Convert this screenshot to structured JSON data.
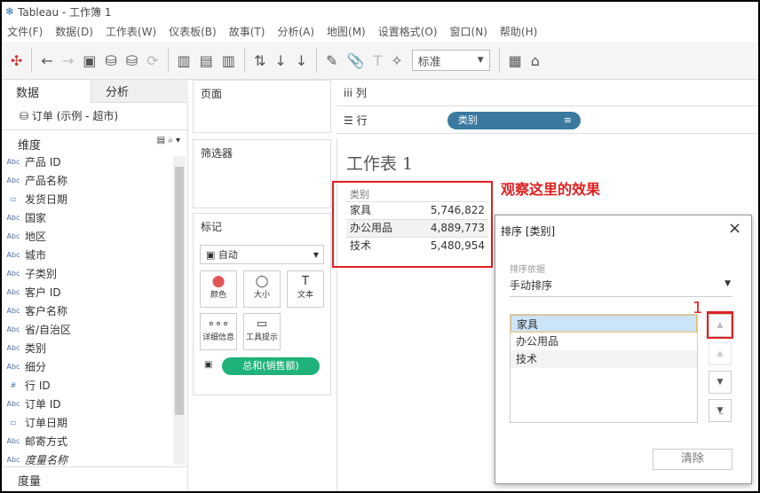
{
  "title": "Tableau - 工作簿 1",
  "menu": [
    "文件(F)",
    "数据(D)",
    "工作表(W)",
    "仪表板(B)",
    "故事(T)",
    "分析(A)",
    "地图(M)",
    "设置格式(O)",
    "窗口(N)",
    "帮助(H)"
  ],
  "toolbar": {
    "fit_select": "标准"
  },
  "side": {
    "tab_data": "数据",
    "tab_analysis": "分析",
    "datasource": "订单 (示例 - 超市)",
    "dimensions": "维度",
    "measures": "度量",
    "fields": [
      {
        "t": "Abc",
        "n": "产品 ID"
      },
      {
        "t": "Abc",
        "n": "产品名称"
      },
      {
        "t": "date",
        "n": "发货日期"
      },
      {
        "t": "Abc",
        "n": "国家"
      },
      {
        "t": "Abc",
        "n": "地区"
      },
      {
        "t": "Abc",
        "n": "城市"
      },
      {
        "t": "Abc",
        "n": "子类别"
      },
      {
        "t": "Abc",
        "n": "客户 ID"
      },
      {
        "t": "Abc",
        "n": "客户名称"
      },
      {
        "t": "Abc",
        "n": "省/自治区"
      },
      {
        "t": "Abc",
        "n": "类别"
      },
      {
        "t": "Abc",
        "n": "细分"
      },
      {
        "t": "#",
        "n": "行 ID"
      },
      {
        "t": "Abc",
        "n": "订单 ID"
      },
      {
        "t": "date",
        "n": "订单日期"
      },
      {
        "t": "Abc",
        "n": "邮寄方式"
      },
      {
        "t": "Abc",
        "n": "度量名称"
      }
    ]
  },
  "shelves": {
    "pages": "页面",
    "filters": "筛选器",
    "marks": "标记",
    "mark_type": "自动",
    "cards": [
      "颜色",
      "大小",
      "文本",
      "详细信息",
      "工具提示"
    ],
    "measure_pill": "总和(销售额)",
    "columns": "列",
    "rows": "行",
    "row_pill": "类别"
  },
  "sheet": {
    "title": "工作表 1",
    "header": "类别",
    "rows": [
      {
        "c": "家具",
        "v": "5,746,822"
      },
      {
        "c": "办公用品",
        "v": "4,889,773"
      },
      {
        "c": "技术",
        "v": "5,480,954"
      }
    ],
    "annotation": "观察这里的效果",
    "marker": "1"
  },
  "dialog": {
    "title": "排序 [类别]",
    "sort_by_label": "排序依据",
    "sort_by": "手动排序",
    "items": [
      "家具",
      "办公用品",
      "技术"
    ],
    "clear": "清除"
  }
}
